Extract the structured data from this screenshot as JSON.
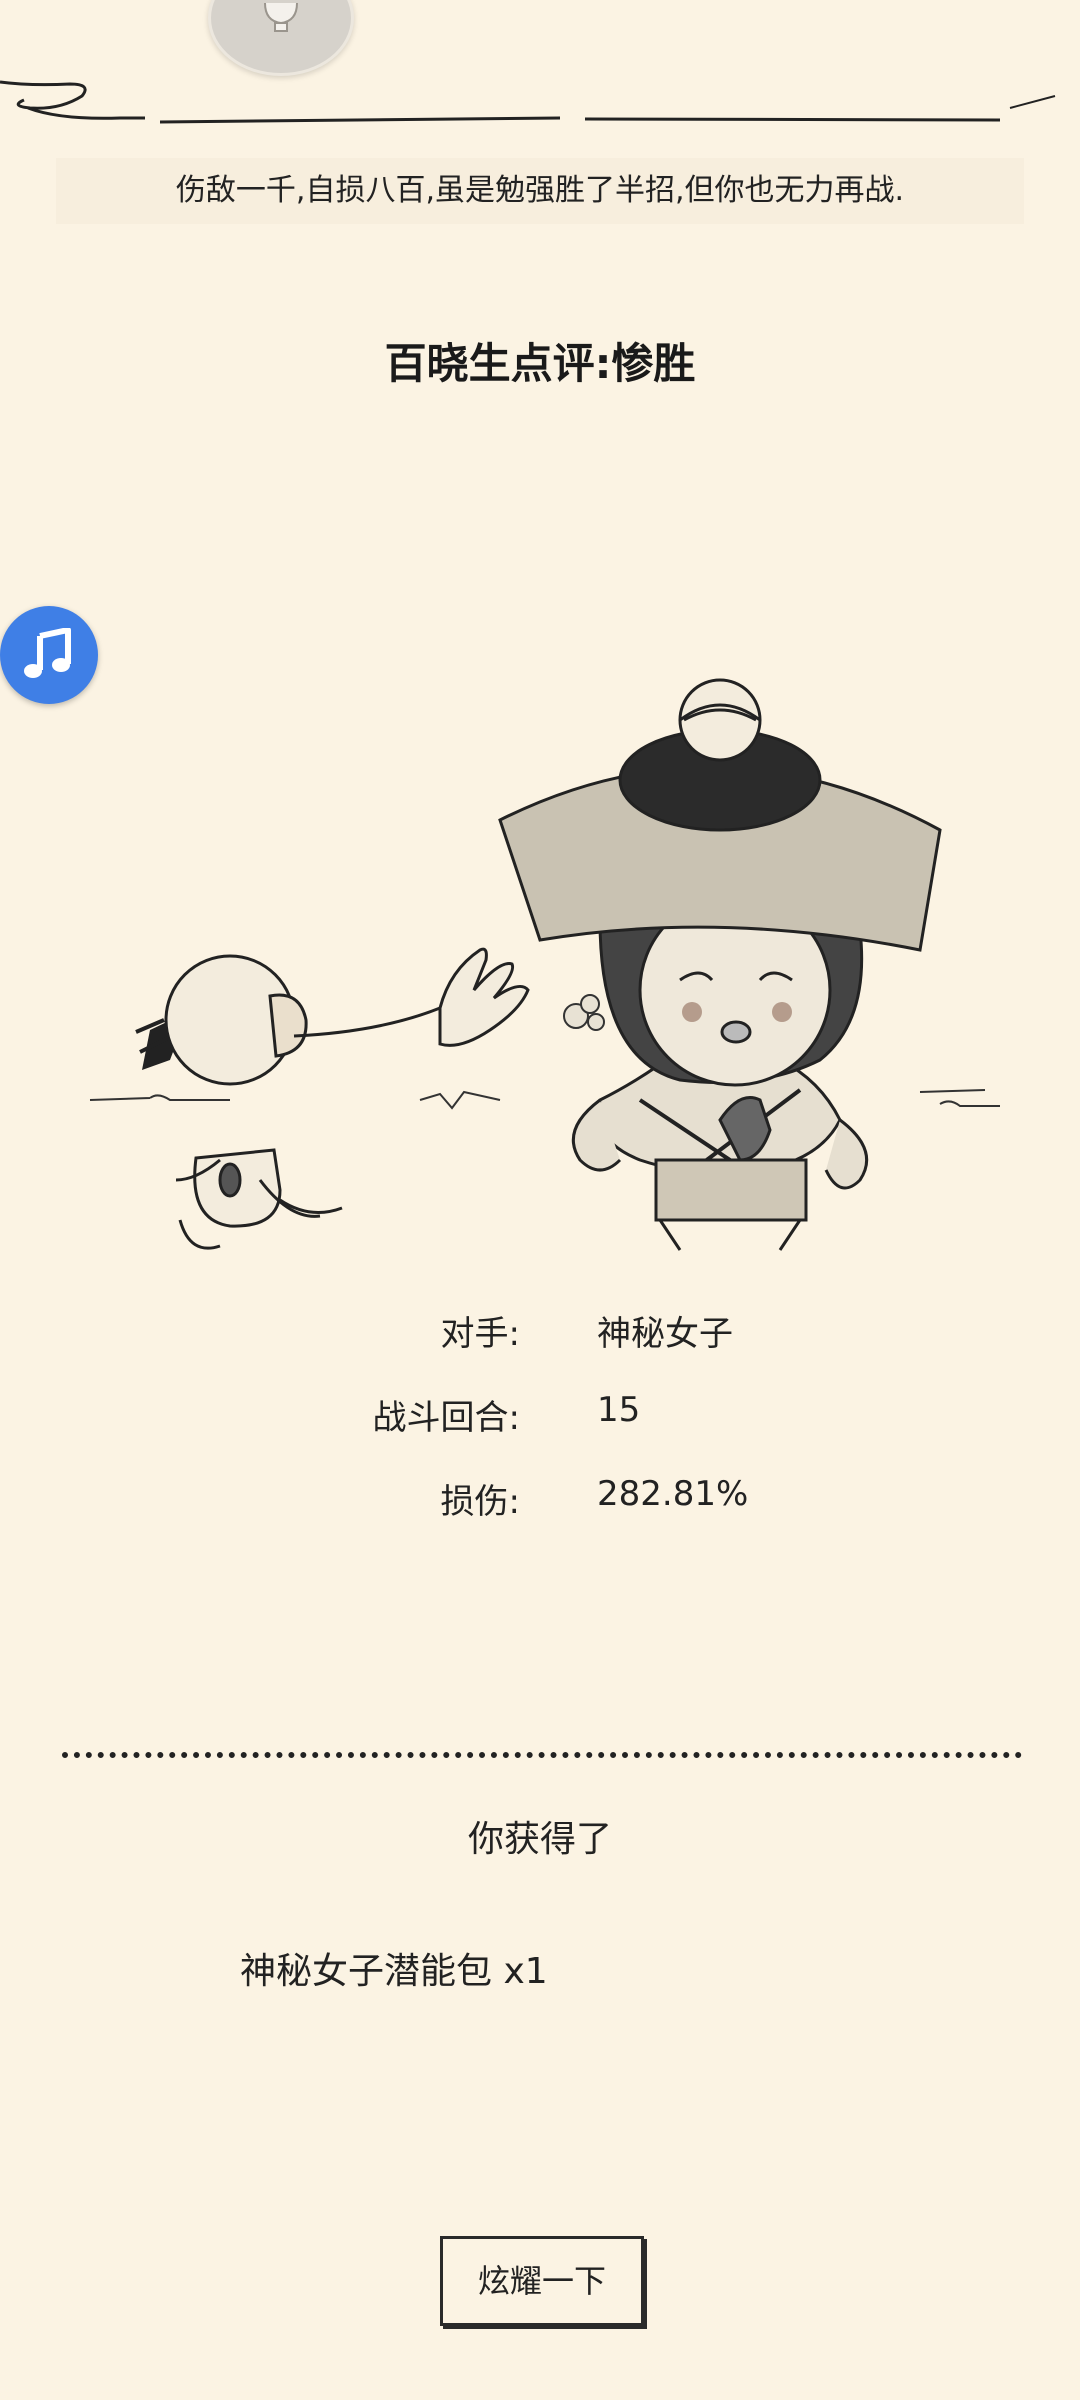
{
  "message": "伤敌一千,自损八百,虽是勉强胜了半招,但你也无力再战.",
  "verdict": "百晓生点评:惨胜",
  "stats": {
    "opponent_label": "对手:",
    "opponent_value": "神秘女子",
    "rounds_label": "战斗回合:",
    "rounds_value": "15",
    "damage_label": "损伤:",
    "damage_value": "282.81%"
  },
  "reward": {
    "title": "你获得了",
    "item": "神秘女子潜能包 x1"
  },
  "share_button": "炫耀一下",
  "icons": {
    "music": "music-note-icon",
    "top": "bell-icon"
  },
  "colors": {
    "background": "#fbf3e3",
    "music_button": "#3f7fe6",
    "ink": "#1c1c1c"
  }
}
